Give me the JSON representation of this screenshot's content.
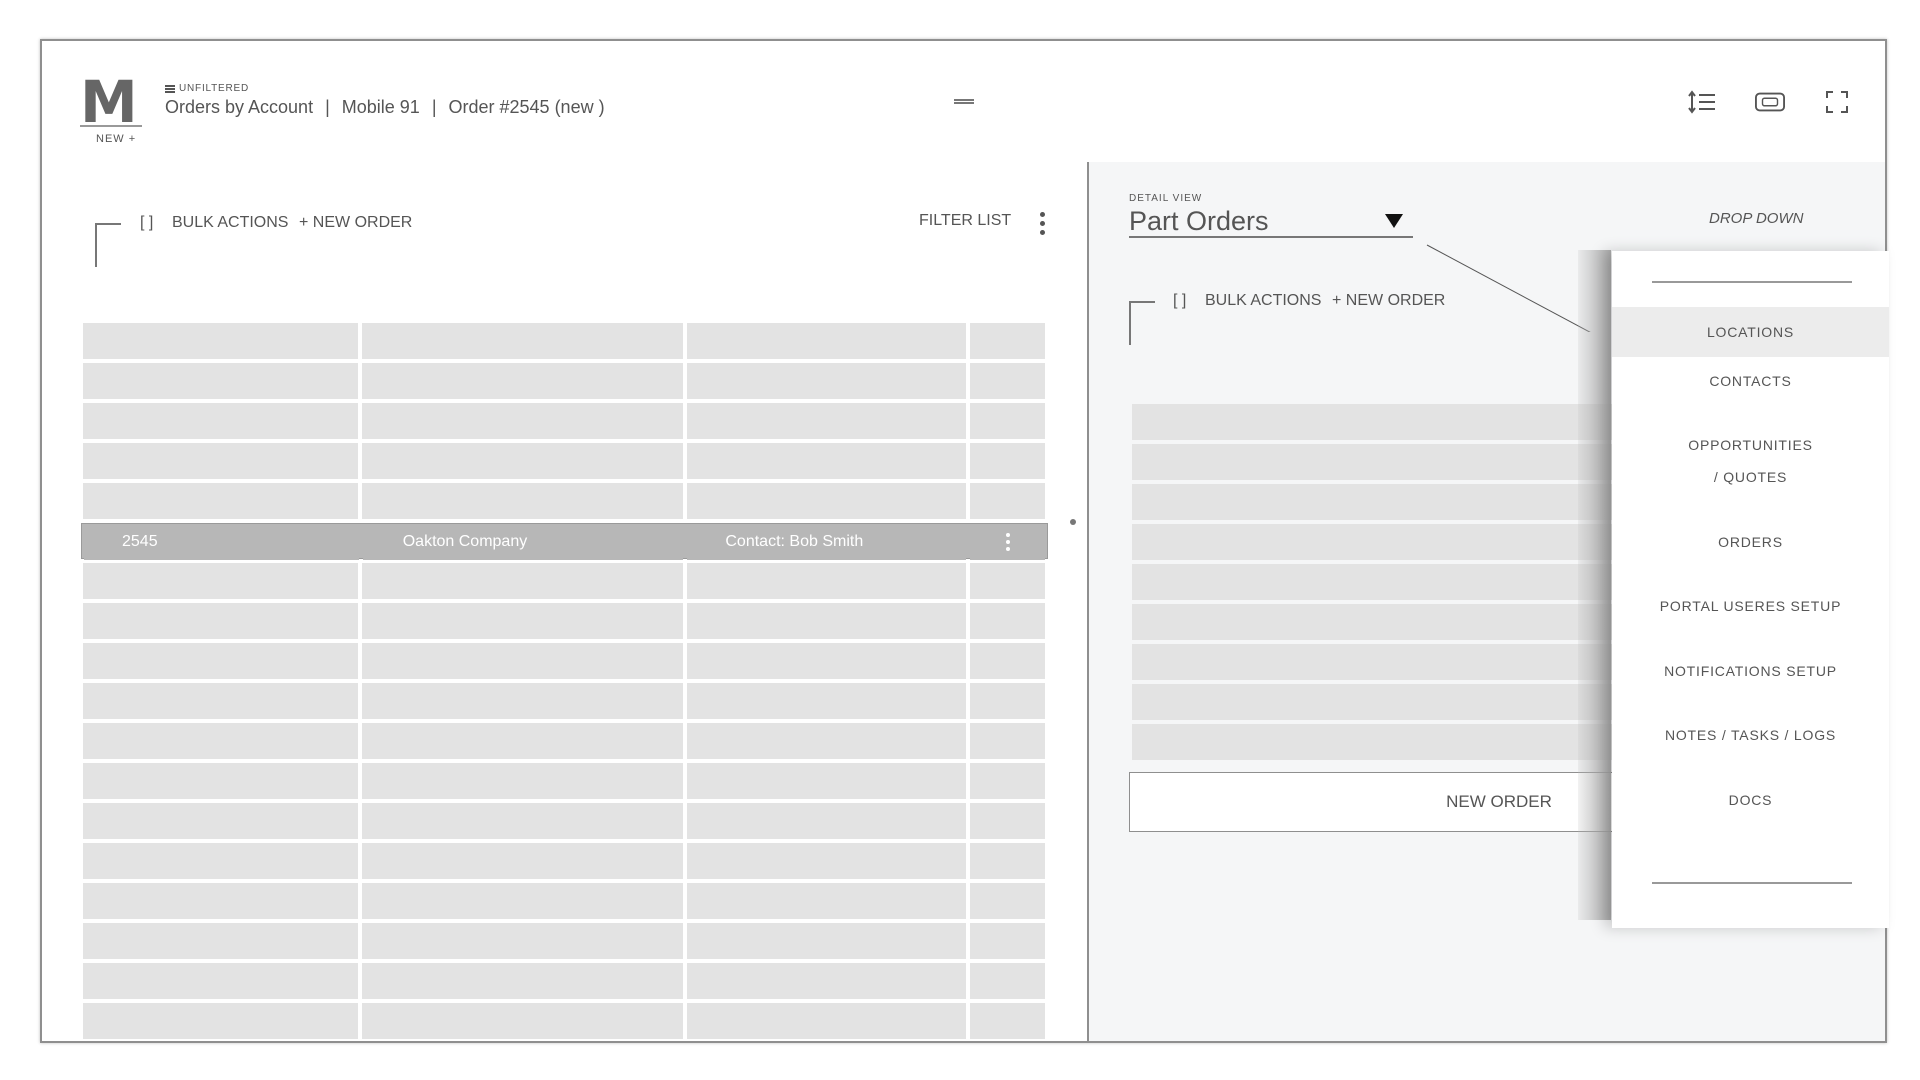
{
  "header": {
    "logo_letter": "M",
    "logo_new_label": "NEW +",
    "filter_label": "UNFILTERED",
    "breadcrumb": [
      "Orders by Account",
      "Mobile 91",
      "Order #2545 (new )"
    ],
    "separator": "|",
    "icons": [
      "line-spacing-icon",
      "card-view-icon",
      "fullscreen-icon"
    ]
  },
  "left": {
    "bracket_label": "[ ]",
    "bulk_actions_label": "BULK ACTIONS",
    "new_order_label": "+ NEW ORDER",
    "filter_list_label": "FILTER LIST",
    "selected_row": {
      "order_id": "2545",
      "company": "Oakton Company",
      "contact": "Contact: Bob Smith"
    },
    "row_count": 18,
    "selected_index": 5
  },
  "detail": {
    "label": "DETAIL VIEW",
    "value": "Part Orders",
    "dropdown_caption": "DROP DOWN",
    "bracket_label": "[ ]",
    "bulk_actions_label": "BULK ACTIONS",
    "new_order_label": "+ NEW ORDER",
    "new_order_button": "NEW ORDER"
  },
  "menu": {
    "items": [
      {
        "label": "LOCATIONS",
        "active": true
      },
      {
        "label": "CONTACTS"
      },
      {
        "label": "OPPORTUNITIES",
        "label2": "/ QUOTES"
      },
      {
        "label": "ORDERS"
      },
      {
        "label": "PORTAL USERES SETUP"
      },
      {
        "label": "NOTIFICATIONS SETUP"
      },
      {
        "label": "NOTES / TASKS / LOGS"
      },
      {
        "label": "DOCS"
      }
    ]
  },
  "colors": {
    "cell": "#e3e3e3",
    "selected_row": "#b7b7b7",
    "panel_bg": "#f5f6f7",
    "border": "#8f8f8f"
  }
}
